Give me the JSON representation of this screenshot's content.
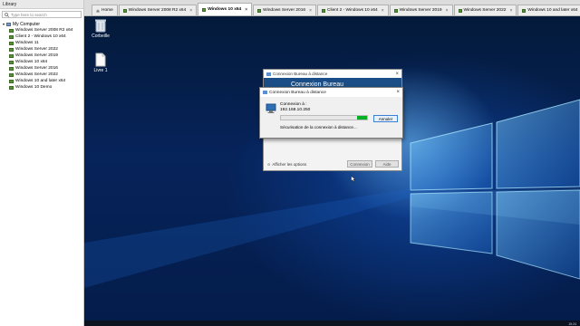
{
  "library": {
    "title": "Library",
    "search_placeholder": "Type here to search",
    "root": "My Computer",
    "items": [
      "Windows Server 2008 R2 x64",
      "Client 2 - Windows 10 x64",
      "Windows 11",
      "Windows Server 2022",
      "Windows Server 2019",
      "Windows 10 x64",
      "Windows Server 2016",
      "Windows Server 2022",
      "Windows 10 and later x64",
      "Windows 10 Demo"
    ]
  },
  "tabs": [
    {
      "label": "Home",
      "active": false
    },
    {
      "label": "Windows Server 2008 R2 x64",
      "active": false
    },
    {
      "label": "Windows 10 x64",
      "active": true
    },
    {
      "label": "Windows Server 2016",
      "active": false
    },
    {
      "label": "Client 2 - Windows 10 x64",
      "active": false
    },
    {
      "label": "Windows Server 2019",
      "active": false
    },
    {
      "label": "Windows Server 2022",
      "active": false
    },
    {
      "label": "Windows 10 and later x64",
      "active": false
    }
  ],
  "desktop": {
    "icons": [
      {
        "label": "Corbeille",
        "icon": "recycle-bin-icon"
      },
      {
        "label": "Livre 1",
        "icon": "document-icon"
      }
    ],
    "clock": "15:24"
  },
  "rdp_background": {
    "title": "Connexion Bureau à distance",
    "banner": "Connexion Bureau",
    "show_options": "Afficher les options",
    "connect_label": "Connexion",
    "help_label": "Aide"
  },
  "rdp_dialog": {
    "title": "Connexion Bureau à distance",
    "connecting_label": "Connexion à :",
    "address": "192.168.10.250",
    "cancel_label": "Annuler",
    "status": "Sécurisation de la connexion à distance...",
    "progress_fraction": 0.12,
    "progress_color": "#06b025"
  },
  "colors": {
    "accent": "#1b4e86",
    "desktop_bg": "#06235a"
  }
}
